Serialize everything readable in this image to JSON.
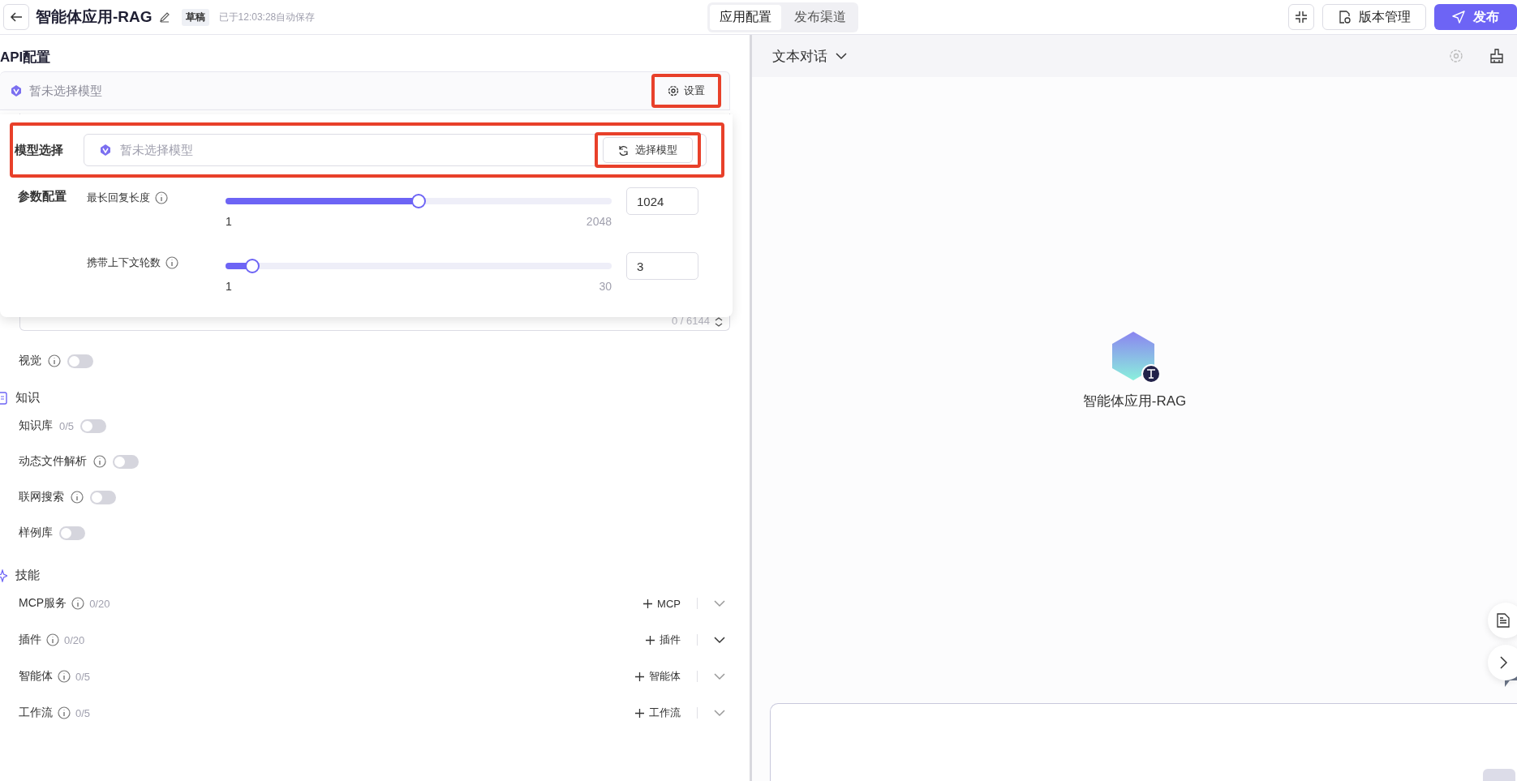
{
  "header": {
    "title": "智能体应用-RAG",
    "badge": "草稿",
    "save_status": "已于12:03:28自动保存",
    "tabs": [
      {
        "label": "应用配置",
        "selected": true
      },
      {
        "label": "发布渠道",
        "selected": false
      }
    ],
    "version_button": "版本管理",
    "publish_button": "发布"
  },
  "config": {
    "title": "API配置",
    "model_bar": {
      "placeholder": "暂未选择模型",
      "settings_button": "设置",
      "highlighted": true
    },
    "popover": {
      "highlighted": true,
      "model_label": "模型选择",
      "model_placeholder": "暂未选择模型",
      "select_button": {
        "label": "选择模型",
        "highlighted": true
      },
      "params_label": "参数配置",
      "sliders": [
        {
          "label": "最长回复长度",
          "level": 0.5,
          "min": "1",
          "max": "2048",
          "value": "1024"
        },
        {
          "label": "携带上下文轮数",
          "level": 0.07,
          "min": "1",
          "max": "30",
          "value": "3"
        }
      ]
    },
    "prompt_counter": "0 / 6144",
    "vision": {
      "label": "视觉",
      "info": true,
      "on": false
    },
    "knowledge": {
      "title": "知识",
      "toggles": [
        {
          "label": "知识库",
          "count": "0/5",
          "info": false,
          "on": false
        },
        {
          "label": "动态文件解析",
          "info": true,
          "on": false
        },
        {
          "label": "联网搜索",
          "info": true,
          "on": false
        },
        {
          "label": "样例库",
          "info": false,
          "on": false
        }
      ]
    },
    "skills": {
      "title": "技能",
      "items": [
        {
          "label": "MCP服务",
          "count": "0/20",
          "add": "MCP",
          "hover": false
        },
        {
          "label": "插件",
          "count": "0/20",
          "add": "插件",
          "hover": true
        },
        {
          "label": "智能体",
          "count": "0/5",
          "add": "智能体",
          "hover": false
        },
        {
          "label": "工作流",
          "count": "0/5",
          "add": "工作流",
          "hover": false
        }
      ]
    }
  },
  "chat": {
    "mode": "文本对话",
    "agent_name": "智能体应用-RAG"
  }
}
